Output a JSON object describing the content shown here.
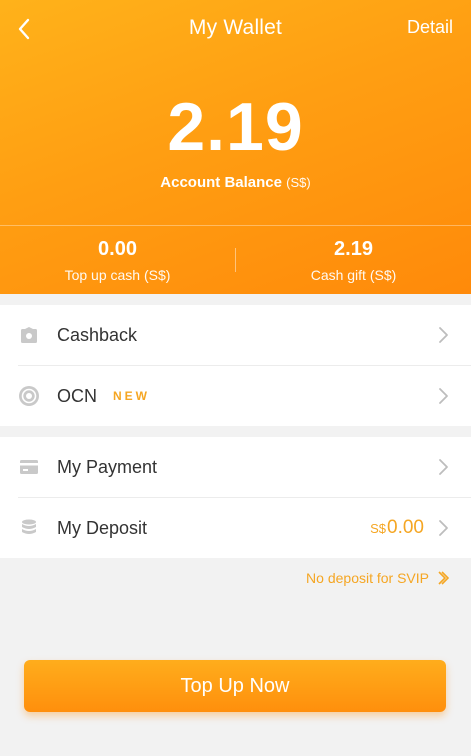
{
  "header": {
    "title": "My Wallet",
    "detail_label": "Detail",
    "balance": "2.19",
    "balance_label": "Account Balance",
    "balance_unit": "(S$)",
    "topup_cash_value": "0.00",
    "topup_cash_label": "Top up cash (S$)",
    "cash_gift_value": "2.19",
    "cash_gift_label": "Cash gift (S$)",
    "gradient_colors": [
      "#ffb21a",
      "#ff8a0a"
    ]
  },
  "menu_group_1": [
    {
      "label": "Cashback",
      "icon": "cashback-icon"
    },
    {
      "label": "OCN",
      "icon": "ocn-coin-icon",
      "badge": "NEW"
    }
  ],
  "menu_group_2": [
    {
      "label": "My Payment",
      "icon": "card-icon"
    },
    {
      "label": "My Deposit",
      "icon": "stack-icon",
      "value_currency": "S$",
      "value": "0.00"
    }
  ],
  "svip_link": "No deposit for SVIP",
  "topup_button": "Top Up Now",
  "colors": {
    "accent": "#f5a623",
    "text": "#333333",
    "background": "#f2f2f2"
  }
}
